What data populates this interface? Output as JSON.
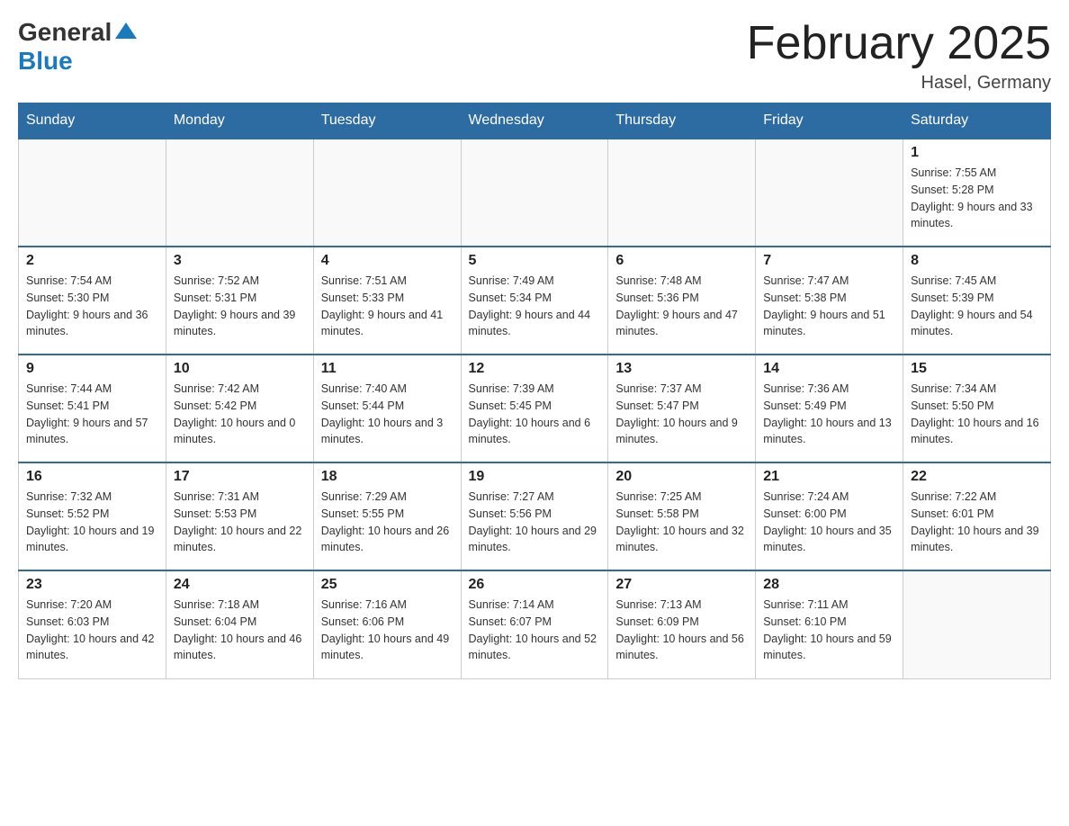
{
  "logo": {
    "general": "General",
    "blue": "Blue"
  },
  "title": "February 2025",
  "subtitle": "Hasel, Germany",
  "days_of_week": [
    "Sunday",
    "Monday",
    "Tuesday",
    "Wednesday",
    "Thursday",
    "Friday",
    "Saturday"
  ],
  "weeks": [
    [
      {
        "day": "",
        "info": ""
      },
      {
        "day": "",
        "info": ""
      },
      {
        "day": "",
        "info": ""
      },
      {
        "day": "",
        "info": ""
      },
      {
        "day": "",
        "info": ""
      },
      {
        "day": "",
        "info": ""
      },
      {
        "day": "1",
        "info": "Sunrise: 7:55 AM\nSunset: 5:28 PM\nDaylight: 9 hours and 33 minutes."
      }
    ],
    [
      {
        "day": "2",
        "info": "Sunrise: 7:54 AM\nSunset: 5:30 PM\nDaylight: 9 hours and 36 minutes."
      },
      {
        "day": "3",
        "info": "Sunrise: 7:52 AM\nSunset: 5:31 PM\nDaylight: 9 hours and 39 minutes."
      },
      {
        "day": "4",
        "info": "Sunrise: 7:51 AM\nSunset: 5:33 PM\nDaylight: 9 hours and 41 minutes."
      },
      {
        "day": "5",
        "info": "Sunrise: 7:49 AM\nSunset: 5:34 PM\nDaylight: 9 hours and 44 minutes."
      },
      {
        "day": "6",
        "info": "Sunrise: 7:48 AM\nSunset: 5:36 PM\nDaylight: 9 hours and 47 minutes."
      },
      {
        "day": "7",
        "info": "Sunrise: 7:47 AM\nSunset: 5:38 PM\nDaylight: 9 hours and 51 minutes."
      },
      {
        "day": "8",
        "info": "Sunrise: 7:45 AM\nSunset: 5:39 PM\nDaylight: 9 hours and 54 minutes."
      }
    ],
    [
      {
        "day": "9",
        "info": "Sunrise: 7:44 AM\nSunset: 5:41 PM\nDaylight: 9 hours and 57 minutes."
      },
      {
        "day": "10",
        "info": "Sunrise: 7:42 AM\nSunset: 5:42 PM\nDaylight: 10 hours and 0 minutes."
      },
      {
        "day": "11",
        "info": "Sunrise: 7:40 AM\nSunset: 5:44 PM\nDaylight: 10 hours and 3 minutes."
      },
      {
        "day": "12",
        "info": "Sunrise: 7:39 AM\nSunset: 5:45 PM\nDaylight: 10 hours and 6 minutes."
      },
      {
        "day": "13",
        "info": "Sunrise: 7:37 AM\nSunset: 5:47 PM\nDaylight: 10 hours and 9 minutes."
      },
      {
        "day": "14",
        "info": "Sunrise: 7:36 AM\nSunset: 5:49 PM\nDaylight: 10 hours and 13 minutes."
      },
      {
        "day": "15",
        "info": "Sunrise: 7:34 AM\nSunset: 5:50 PM\nDaylight: 10 hours and 16 minutes."
      }
    ],
    [
      {
        "day": "16",
        "info": "Sunrise: 7:32 AM\nSunset: 5:52 PM\nDaylight: 10 hours and 19 minutes."
      },
      {
        "day": "17",
        "info": "Sunrise: 7:31 AM\nSunset: 5:53 PM\nDaylight: 10 hours and 22 minutes."
      },
      {
        "day": "18",
        "info": "Sunrise: 7:29 AM\nSunset: 5:55 PM\nDaylight: 10 hours and 26 minutes."
      },
      {
        "day": "19",
        "info": "Sunrise: 7:27 AM\nSunset: 5:56 PM\nDaylight: 10 hours and 29 minutes."
      },
      {
        "day": "20",
        "info": "Sunrise: 7:25 AM\nSunset: 5:58 PM\nDaylight: 10 hours and 32 minutes."
      },
      {
        "day": "21",
        "info": "Sunrise: 7:24 AM\nSunset: 6:00 PM\nDaylight: 10 hours and 35 minutes."
      },
      {
        "day": "22",
        "info": "Sunrise: 7:22 AM\nSunset: 6:01 PM\nDaylight: 10 hours and 39 minutes."
      }
    ],
    [
      {
        "day": "23",
        "info": "Sunrise: 7:20 AM\nSunset: 6:03 PM\nDaylight: 10 hours and 42 minutes."
      },
      {
        "day": "24",
        "info": "Sunrise: 7:18 AM\nSunset: 6:04 PM\nDaylight: 10 hours and 46 minutes."
      },
      {
        "day": "25",
        "info": "Sunrise: 7:16 AM\nSunset: 6:06 PM\nDaylight: 10 hours and 49 minutes."
      },
      {
        "day": "26",
        "info": "Sunrise: 7:14 AM\nSunset: 6:07 PM\nDaylight: 10 hours and 52 minutes."
      },
      {
        "day": "27",
        "info": "Sunrise: 7:13 AM\nSunset: 6:09 PM\nDaylight: 10 hours and 56 minutes."
      },
      {
        "day": "28",
        "info": "Sunrise: 7:11 AM\nSunset: 6:10 PM\nDaylight: 10 hours and 59 minutes."
      },
      {
        "day": "",
        "info": ""
      }
    ]
  ]
}
